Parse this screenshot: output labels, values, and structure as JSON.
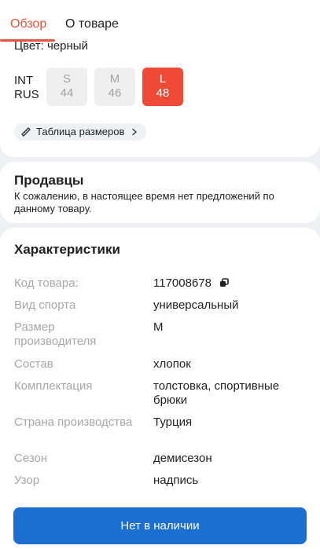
{
  "tabs": [
    {
      "label": "Обзор",
      "active": true
    },
    {
      "label": "О товаре",
      "active": false
    }
  ],
  "color_line": "Цвет: черный",
  "sizes": {
    "labels": [
      "INT",
      "RUS"
    ],
    "options": [
      {
        "int": "S",
        "rus": "44",
        "selected": false
      },
      {
        "int": "M",
        "rus": "46",
        "selected": false
      },
      {
        "int": "L",
        "rus": "48",
        "selected": true
      }
    ]
  },
  "size_table_label": "Таблица размеров",
  "sellers": {
    "title": "Продавцы",
    "text": "К сожалению, в настоящее время нет предложений по данному товару."
  },
  "characteristics": {
    "title": "Характеристики",
    "rows": [
      {
        "key": "Код товара:",
        "value": "117008678"
      },
      {
        "key": "Вид спорта",
        "value": "универсальный"
      },
      {
        "key": "Размер производителя",
        "value": "M"
      },
      {
        "key": "Состав",
        "value": "хлопок"
      },
      {
        "key": "Комплектация",
        "value": "толстовка, спортивные брюки"
      },
      {
        "key": "Страна производства",
        "value": "Турция"
      },
      {
        "key": "Сезон",
        "value": "демисезон"
      },
      {
        "key": "Узор",
        "value": "надпись"
      }
    ]
  },
  "buy_button_label": "Нет в наличии",
  "icons": {
    "size_table": "ruler-icon",
    "chevron": "chevron-right-icon",
    "copy": "copy-icon"
  },
  "colors": {
    "accent": "#e4533a",
    "selected_size": "#ee4a35",
    "primary_button": "#1a6fd1"
  }
}
